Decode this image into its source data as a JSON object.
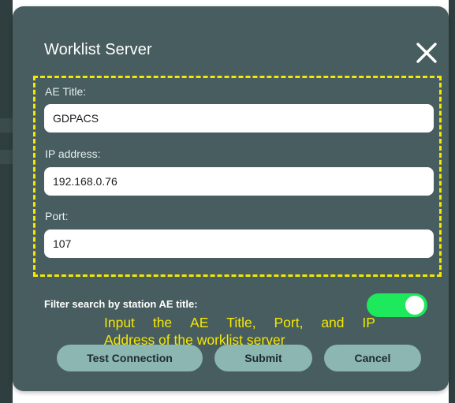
{
  "dialog": {
    "title": "Worklist Server"
  },
  "form": {
    "ae_title_label": "AE Title:",
    "ae_title_value": "GDPACS",
    "ip_label": "IP address:",
    "ip_value": "192.168.0.76",
    "port_label": "Port:",
    "port_value": "107"
  },
  "filter": {
    "label": "Filter search by station AE title:",
    "enabled": true
  },
  "annotation": {
    "line1_words": [
      "Input",
      "the",
      "AE",
      "Title,",
      "Port,",
      "and",
      "IP"
    ],
    "line2": "Address of the worklist server"
  },
  "buttons": {
    "test_connection": "Test Connection",
    "submit": "Submit",
    "cancel": "Cancel"
  },
  "colors": {
    "dialog_bg": "#485d5f",
    "highlight": "#f2e800",
    "toggle_on": "#1ee85b",
    "button_bg": "#8cb6b1"
  }
}
